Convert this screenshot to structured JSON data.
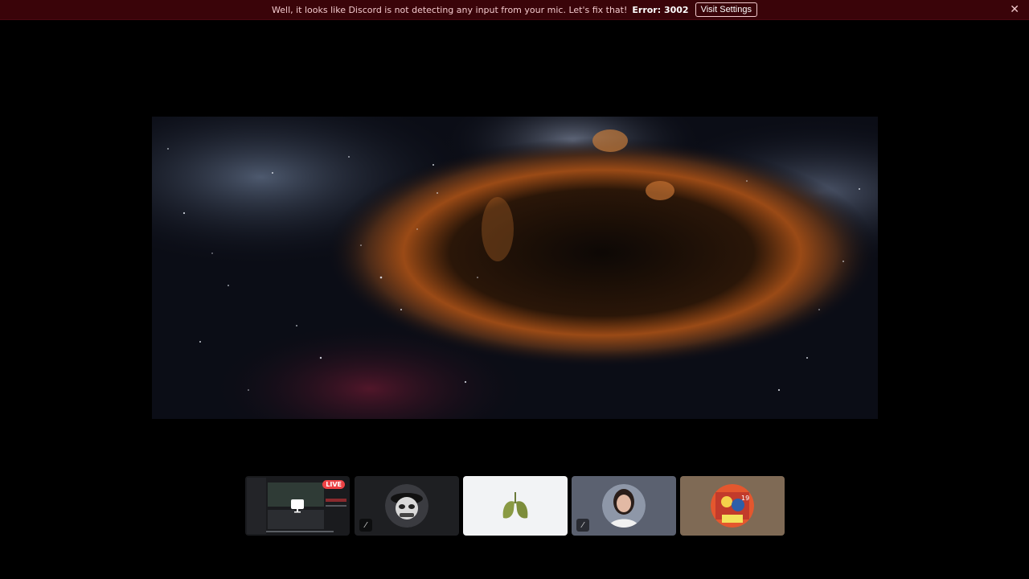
{
  "notice": {
    "message": "Well, it looks like Discord is not detecting any input from your mic. Let's fix that!",
    "error": "Error: 3002",
    "button_label": "Visit Settings",
    "close_glyph": "✕"
  },
  "stream": {
    "icon": "nebula-stream-image"
  },
  "tiles": [
    {
      "kind": "stream",
      "badge": "LIVE",
      "icon": "monitor-icon",
      "bg": "#2b2d31"
    },
    {
      "kind": "user",
      "icon": "masked-avatar",
      "muted": true,
      "mute_glyph": "⁄",
      "bg": "#1e1f22"
    },
    {
      "kind": "user",
      "icon": "lungs-avatar",
      "muted": false,
      "bg": "#f2f3f5"
    },
    {
      "kind": "user",
      "icon": "woman-avatar",
      "muted": true,
      "mute_glyph": "⁄",
      "bg": "#5b6170"
    },
    {
      "kind": "user",
      "icon": "anime-avatar",
      "muted": false,
      "bg": "#7f6a55"
    }
  ],
  "colors": {
    "notice_bg": "#3a0409",
    "live_badge": "#ed4245"
  }
}
